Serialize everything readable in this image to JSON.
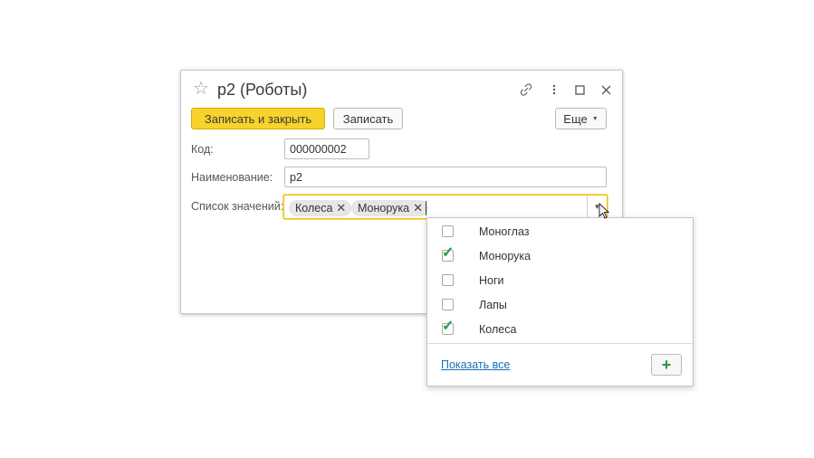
{
  "window": {
    "title": "р2 (Роботы)",
    "icons": [
      "star-icon",
      "link-icon",
      "more-icon",
      "maximize-icon",
      "close-icon"
    ]
  },
  "toolbar": {
    "save_close_label": "Записать и закрыть",
    "save_label": "Записать",
    "more_label": "Еще"
  },
  "form": {
    "code_label": "Код:",
    "code_value": "000000002",
    "name_label": "Наименование:",
    "name_value": "р2",
    "list_label": "Список значений:",
    "selected": [
      "Колеса",
      "Монорука"
    ]
  },
  "dropdown": {
    "items": [
      {
        "label": "Моноглаз",
        "checked": false
      },
      {
        "label": "Монорука",
        "checked": true
      },
      {
        "label": "Ноги",
        "checked": false
      },
      {
        "label": "Лапы",
        "checked": false
      },
      {
        "label": "Колеса",
        "checked": true
      }
    ],
    "show_all_label": "Показать все",
    "add_label": "+"
  },
  "colors": {
    "primary_button": "#f7d32b",
    "focus_border": "#f0c20a",
    "check": "#1e9a44",
    "link": "#1a6fb5"
  }
}
